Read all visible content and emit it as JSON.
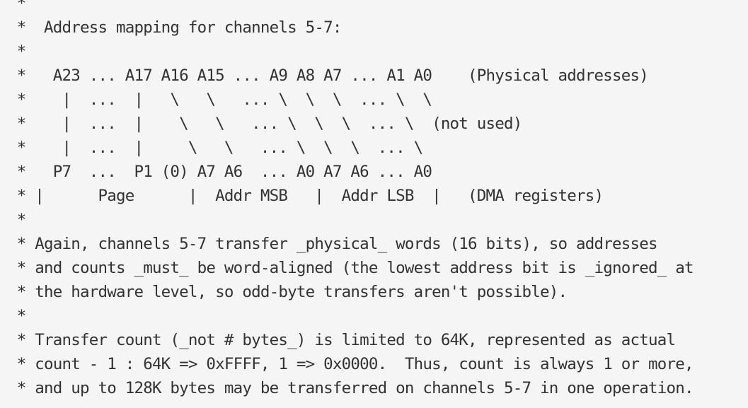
{
  "document": {
    "lines": [
      " *",
      " *  Address mapping for channels 5-7:",
      " *",
      " *   A23 ... A17 A16 A15 ... A9 A8 A7 ... A1 A0    (Physical addresses)",
      " *    |  ...  |   \\   \\   ... \\  \\  \\  ... \\  \\",
      " *    |  ...  |    \\   \\   ... \\  \\  \\  ... \\  (not used)",
      " *    |  ...  |     \\   \\   ... \\  \\  \\  ... \\",
      " *   P7  ...  P1 (0) A7 A6  ... A0 A7 A6 ... A0",
      " * |      Page      |  Addr MSB   |  Addr LSB  |   (DMA registers)",
      " *",
      " * Again, channels 5-7 transfer _physical_ words (16 bits), so addresses",
      " * and counts _must_ be word-aligned (the lowest address bit is _ignored_ at",
      " * the hardware level, so odd-byte transfers aren't possible).",
      " *",
      " * Transfer count (_not # bytes_) is limited to 64K, represented as actual",
      " * count - 1 : 64K => 0xFFFF, 1 => 0x0000.  Thus, count is always 1 or more,",
      " * and up to 128K bytes may be transferred on channels 5-7 in one operation."
    ]
  }
}
